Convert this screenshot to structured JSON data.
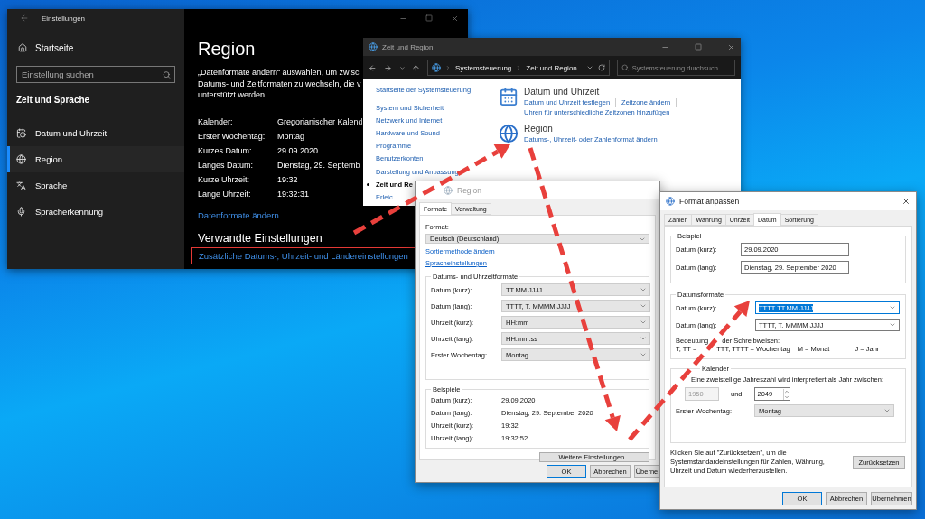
{
  "settings_window": {
    "title": "Einstellungen",
    "home": "Startseite",
    "search": {
      "placeholder": "Einstellung suchen"
    },
    "section": "Zeit und Sprache",
    "nav": [
      {
        "label": "Datum und Uhrzeit",
        "selected": false
      },
      {
        "label": "Region",
        "selected": true
      },
      {
        "label": "Sprache",
        "selected": false
      },
      {
        "label": "Spracherkennung",
        "selected": false
      }
    ],
    "heading": "Region",
    "intro": [
      "„Datenformate ändern“ auswählen, um zwisc",
      "Datums- und Zeitformaten zu wechseln, die v",
      "unterstützt werden."
    ],
    "fields": [
      {
        "label": "Kalender:",
        "value": "Gregorianischer Kalend"
      },
      {
        "label": "Erster Wochentag:",
        "value": "Montag"
      },
      {
        "label": "Kurzes Datum:",
        "value": "29.09.2020"
      },
      {
        "label": "Langes Datum:",
        "value": "Dienstag, 29. Septemb"
      },
      {
        "label": "Kurze Uhrzeit:",
        "value": "19:32"
      },
      {
        "label": "Lange Uhrzeit:",
        "value": "19:32:31"
      }
    ],
    "change_link": "Datenformate ändern",
    "related_heading": "Verwandte Einstellungen",
    "related_link": "Zusätzliche Datums-, Uhrzeit- und Ländereinstellungen"
  },
  "control_panel": {
    "title": "Zeit und Region",
    "breadcrumb": [
      "Systemsteuerung",
      "Zeit und Region"
    ],
    "search": {
      "placeholder": "Systemsteuerung durchsuch…"
    },
    "nav": [
      {
        "label": "Startseite der Systemsteuerung",
        "selected": false
      },
      {
        "label": "System und Sicherheit",
        "selected": false
      },
      {
        "label": "Netzwerk und Internet",
        "selected": false
      },
      {
        "label": "Hardware und Sound",
        "selected": false
      },
      {
        "label": "Programme",
        "selected": false
      },
      {
        "label": "Benutzerkonten",
        "selected": false
      },
      {
        "label": "Darstellung und Anpassung",
        "selected": false
      },
      {
        "label": "Zeit und Re",
        "selected": true
      },
      {
        "label": "Erleic",
        "selected": false
      }
    ],
    "categories": [
      {
        "title": "Datum und Uhrzeit",
        "links": [
          "Datum und Uhrzeit festlegen",
          "Zeitzone ändern",
          "Uhren für unterschiedliche Zeitzonen hinzufügen"
        ]
      },
      {
        "title": "Region",
        "links": [
          "Datums-, Uhrzeit- oder Zahlenformat ändern"
        ]
      }
    ]
  },
  "region_dialog": {
    "title": "Region",
    "tabs": [
      {
        "label": "Formate",
        "selected": true
      },
      {
        "label": "Verwaltung",
        "selected": false
      }
    ],
    "format_label": "Format:",
    "format": "Deutsch (Deutschland)",
    "links": [
      "Sortiermethode ändern",
      "Spracheinstellungen"
    ],
    "formats_group": {
      "title": "Datums- und Uhrzeitformate",
      "rows": [
        {
          "label": "Datum (kurz):",
          "value": "TT.MM.JJJJ"
        },
        {
          "label": "Datum (lang):",
          "value": "TTTT, T. MMMM JJJJ"
        },
        {
          "label": "Uhrzeit (kurz):",
          "value": "HH:mm"
        },
        {
          "label": "Uhrzeit (lang):",
          "value": "HH:mm:ss"
        },
        {
          "label": "Erster Wochentag:",
          "value": "Montag"
        }
      ]
    },
    "examples": {
      "title": "Beispiele",
      "rows": [
        {
          "label": "Datum (kurz):",
          "value": "29.09.2020"
        },
        {
          "label": "Datum (lang):",
          "value": "Dienstag, 29. September 2020"
        },
        {
          "label": "Uhrzeit (kurz):",
          "value": "19:32"
        },
        {
          "label": "Uhrzeit (lang):",
          "value": "19:32:52"
        }
      ]
    },
    "more_button": "Weitere Einstellungen...",
    "buttons": [
      "OK",
      "Abbrechen",
      "Überne"
    ]
  },
  "format_dialog": {
    "title": "Format anpassen",
    "tabs": [
      {
        "label": "Zahlen",
        "selected": false
      },
      {
        "label": "Währung",
        "selected": false
      },
      {
        "label": "Uhrzeit",
        "selected": false
      },
      {
        "label": "Datum",
        "selected": true
      },
      {
        "label": "Sortierung",
        "selected": false
      }
    ],
    "example_group": {
      "title": "Beispiel",
      "rows": [
        {
          "label": "Datum (kurz):",
          "value": "29.09.2020"
        },
        {
          "label": "Datum (lang):",
          "value": "Dienstag, 29. September 2020"
        }
      ]
    },
    "formats_group": {
      "title": "Datumsformate",
      "rows": [
        {
          "label": "Datum (kurz):",
          "value": "TTTT TT.MM.JJJJ",
          "selected": true
        },
        {
          "label": "Datum (lang):",
          "value": "TTTT, T. MMMM JJJJ",
          "selected": false
        }
      ],
      "legend_title": [
        "Bedeutung",
        "der Schreibweisen:"
      ],
      "legend": [
        "T, TT =",
        "TTT, TTTT = Wochentag",
        "M = Monat",
        "J = Jahr"
      ]
    },
    "calendar_group": {
      "title": "Kalender",
      "sentence": "Eine zweistellige Jahreszahl wird interpretiert als Jahr zwischen:",
      "from": {
        "value": "1950",
        "disabled": true
      },
      "and": "und",
      "to": "2049",
      "weekday_label": "Erster Wochentag:",
      "weekday": "Montag"
    },
    "reset_text": "Klicken Sie auf \"Zurücksetzen\", um die Systemstandardeinstellungen für Zahlen, Währung, Uhrzeit und Datum wiederherzustellen.",
    "reset_button": "Zurücksetzen",
    "buttons": [
      "OK",
      "Abbrechen",
      "Übernehmen"
    ]
  }
}
